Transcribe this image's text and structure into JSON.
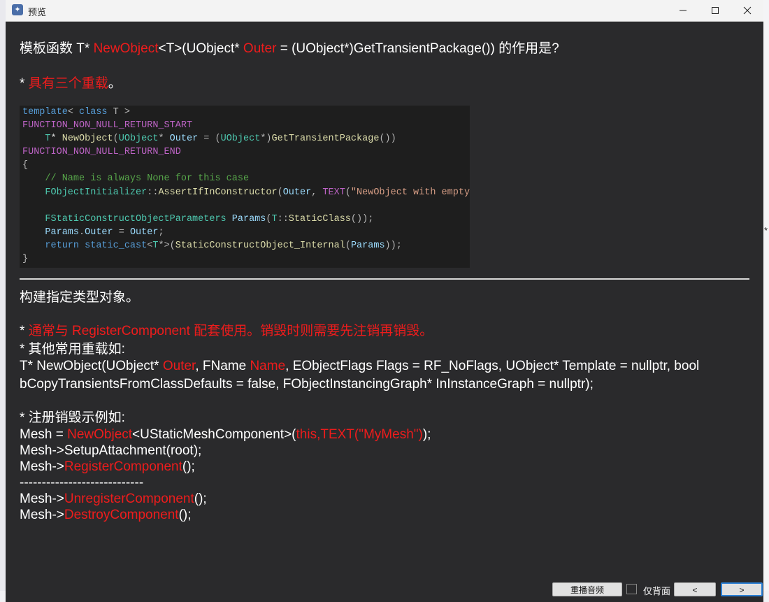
{
  "window": {
    "title": "预览"
  },
  "question": {
    "prefix": "模板函数 T* ",
    "fn_name": "NewObject",
    "mid1": "<T>(UObject* ",
    "param": "Outer",
    "suffix": " = (UObject*)GetTransientPackage()) 的作用是?"
  },
  "note_overloads": {
    "bullet": "* ",
    "text": "具有三个重载",
    "end": "。"
  },
  "code_lines": [
    "template< class T >",
    "FUNCTION_NON_NULL_RETURN_START",
    "    T* NewObject(UObject* Outer = (UObject*)GetTransientPackage())",
    "FUNCTION_NON_NULL_RETURN_END",
    "{",
    "    // Name is always None for this case",
    "    FObjectInitializer::AssertIfInConstructor(Outer, TEXT(\"NewObject with empty name",
    "",
    "    FStaticConstructObjectParameters Params(T::StaticClass());",
    "    Params.Outer = Outer;",
    "    return static_cast<T*>(StaticConstructObject_Internal(Params));",
    "}"
  ],
  "answer": {
    "line1": "构建指定类型对象。",
    "line2_bullet": "* ",
    "line2_red": "通常与 RegisterComponent 配套使用。销毁时则需要先注销再销毁。",
    "line3": "* 其他常用重载如:",
    "line4_a": "T* NewObject(UObject* ",
    "line4_b": "Outer",
    "line4_c": ", FName ",
    "line4_d": "Name",
    "line4_e": ", EObjectFlags Flags = RF_NoFlags, UObject* Template = nullptr, bool",
    "line5": "bCopyTransientsFromClassDefaults = false, FObjectInstancingGraph* InInstanceGraph = nullptr);",
    "line6": "* 注册销毁示例如:",
    "line7_a": "Mesh = ",
    "line7_b": "NewObject",
    "line7_c": "<UStaticMeshComponent>(",
    "line7_d": "this,TEXT(\"MyMesh\")",
    "line7_e": ");",
    "line8": "Mesh->SetupAttachment(root);",
    "line9_a": "Mesh->",
    "line9_b": "RegisterComponent",
    "line9_c": "();",
    "line10": "----------------------------",
    "line11_a": "Mesh->",
    "line11_b": "UnregisterComponent",
    "line11_c": "();",
    "line12_a": "Mesh->",
    "line12_b": "DestroyComponent",
    "line12_c": "();"
  },
  "controls": {
    "replay_label": "重播音频",
    "back_only_label": "仅背面",
    "prev_label": "<",
    "next_label": ">"
  },
  "colors": {
    "accent_red": "#ee1c1c",
    "background": "#2a2a2c",
    "focus_blue": "#2a7fd4"
  }
}
